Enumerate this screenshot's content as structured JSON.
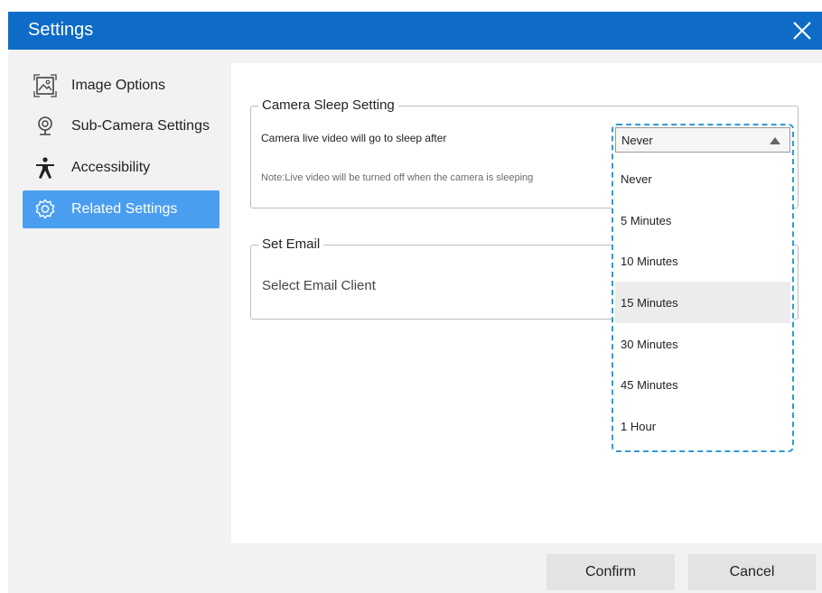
{
  "window": {
    "title": "Settings"
  },
  "sidebar": {
    "items": [
      {
        "label": "Image Options",
        "icon": "image-icon"
      },
      {
        "label": "Sub-Camera Settings",
        "icon": "webcam-icon"
      },
      {
        "label": "Accessibility",
        "icon": "accessibility-icon"
      },
      {
        "label": "Related Settings",
        "icon": "gear-icon",
        "active": true
      }
    ]
  },
  "camera_sleep": {
    "title": "Camera Sleep Setting",
    "label": "Camera live video will go to sleep after",
    "note": "Note:Live video will be turned off when the camera is sleeping",
    "selected": "Never",
    "options": [
      "Never",
      "5 Minutes",
      "10 Minutes",
      "15 Minutes",
      "30 Minutes",
      "45 Minutes",
      "1 Hour"
    ],
    "hovered_option": "15 Minutes"
  },
  "email": {
    "title": "Set Email",
    "label": "Select Email Client"
  },
  "footer": {
    "confirm_label": "Confirm",
    "cancel_label": "Cancel"
  },
  "colors": {
    "titlebar": "#0e6bc7",
    "sidebar_active": "#4a9ef0",
    "dropdown_outline": "#2f9bd6"
  }
}
